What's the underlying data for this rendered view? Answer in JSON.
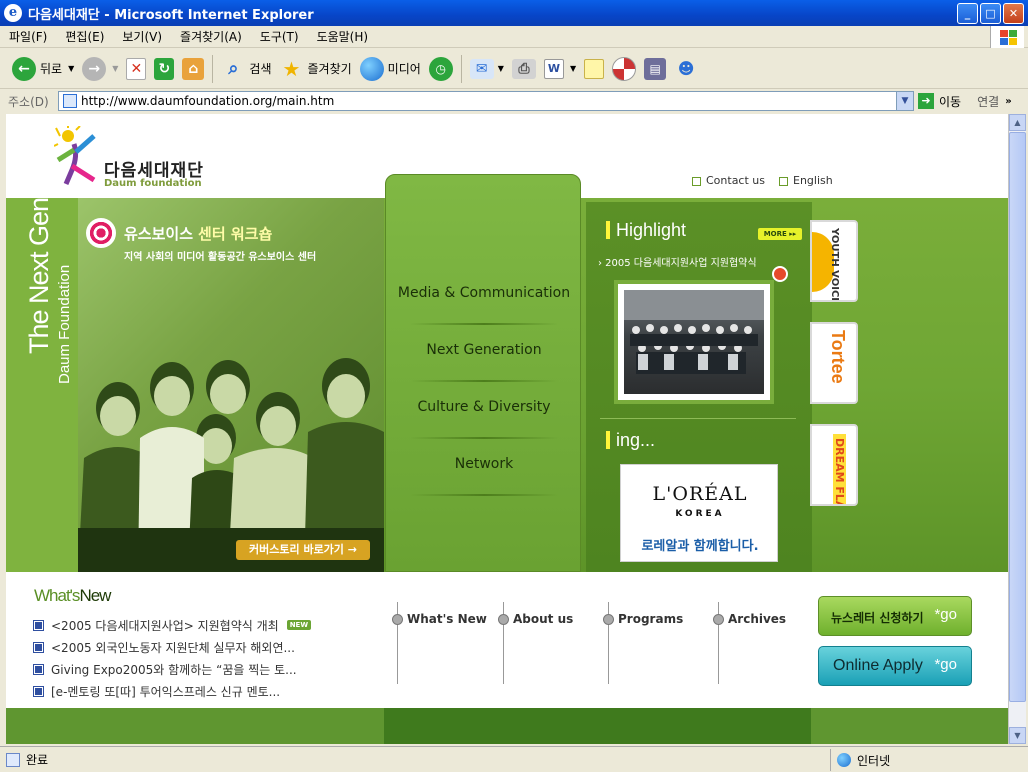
{
  "window": {
    "title": "다음세대재단 - Microsoft Internet Explorer",
    "controls": {
      "min": "_",
      "max": "□",
      "close": "✕"
    }
  },
  "menu": [
    "파일(F)",
    "편집(E)",
    "보기(V)",
    "즐겨찾기(A)",
    "도구(T)",
    "도움말(H)"
  ],
  "toolbar": {
    "back": "뒤로",
    "search": "검색",
    "favorites": "즐겨찾기",
    "media": "미디어"
  },
  "address": {
    "label": "주소(D)",
    "url": "http://www.daumfoundation.org/main.htm",
    "go": "이동",
    "links": "연결"
  },
  "status": {
    "text": "완료",
    "zone": "인터넷"
  },
  "site": {
    "logo_ko": "다음세대재단",
    "logo_en": "Daum foundation",
    "toplinks": [
      "Contact us",
      "English"
    ],
    "brand_vertical_1": "The Next Generation",
    "brand_vertical_2": "Daum Foundation",
    "hero_title_1": "유스보이스",
    "hero_title_2": "센터 워크숍",
    "hero_sub": "지역 사회의 미디어 활동공간 유스보이스 센터",
    "cover_link": "커버스토리 바로가기 →",
    "nav": [
      "Media & Communication",
      "Next Generation",
      "Culture & Diversity",
      "Network"
    ],
    "highlight_title": "Highlight",
    "more": "MORE ▸▸",
    "highlight_sub": "› 2005 다음세대지원사업 지원협약식",
    "ing_title": "ing...",
    "loreal_brand": "L'ORÉAL",
    "loreal_korea": "KOREA",
    "loreal_msg": "로레알과 함께합니다.",
    "side_buttons": [
      "YOUTH VOICE",
      "Tortee",
      "DREAM FLASH"
    ],
    "whatsnew_title_a": "What's",
    "whatsnew_title_b": "New",
    "whatsnew_items": [
      "<2005 다음세대지원사업> 지원협약식 개최",
      "<2005 외국인노동자 지원단체 실무자 해외연...",
      "Giving Expo2005와 함께하는 “꿈을 찍는 토...",
      "[e-멘토링 또[따] 투어익스프레스 신규 멘토..."
    ],
    "new_badge": "NEW",
    "bottom_menu": [
      "What's New",
      "About us",
      "Programs",
      "Archives"
    ],
    "newsletter": "뉴스레터 신청하기",
    "online_apply": "Online Apply",
    "go": "*go"
  },
  "colors": {
    "green": "#6fa634",
    "dark_green": "#3f7a1d",
    "teal": "#1aa0b6"
  }
}
